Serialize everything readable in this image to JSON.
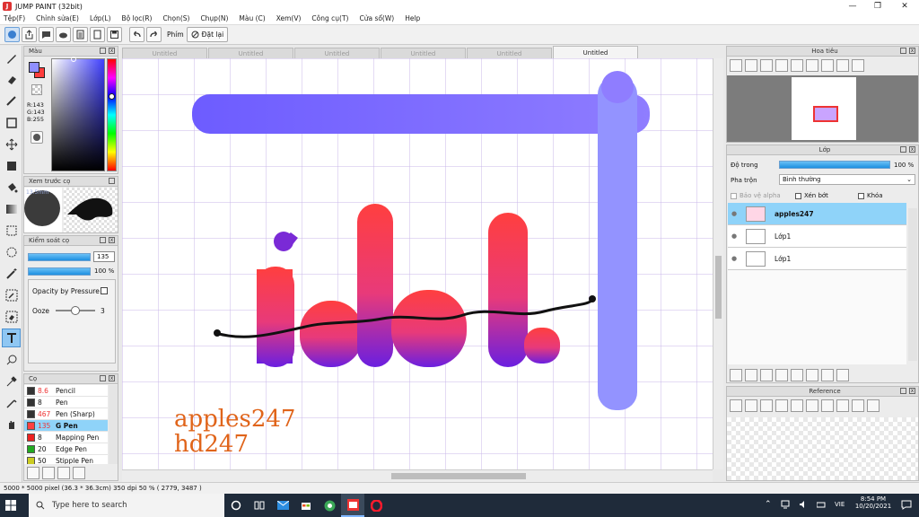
{
  "window": {
    "title": "JUMP PAINT (32bit)",
    "app_letter": "J"
  },
  "menu": [
    "Tệp(F)",
    "Chỉnh sửa(E)",
    "Lớp(L)",
    "Bộ lọc(R)",
    "Chọn(S)",
    "Chụp(N)",
    "Màu (C)",
    "Xem(V)",
    "Công cụ(T)",
    "Cửa sổ(W)",
    "Help"
  ],
  "toolbar": {
    "phim_label": "Phím",
    "reset_label": "Đặt lại"
  },
  "tabs": [
    "Untitled",
    "Untitled",
    "Untitled",
    "Untitled",
    "Untitled",
    "Untitled"
  ],
  "color_panel": {
    "title": "Màu",
    "r": "R:143",
    "g": "G:143",
    "b": "B:255",
    "fg_color": "#8f8fff",
    "bg_color": "#ff3c3c"
  },
  "preview_panel": {
    "title": "Xem trước cọ",
    "size_text": "13.5mm"
  },
  "brush_control": {
    "title": "Kiểm soát cọ",
    "size_value": "135",
    "opacity_value": "100 %",
    "opacity_pressure_label": "Opacity by Pressure",
    "ooze_label": "Ooze",
    "ooze_value": "3",
    "ooze_level": 0.5
  },
  "brush_list": {
    "title": "Cọ",
    "items": [
      {
        "num": "8.6",
        "name": "Pencil",
        "color": "#333333",
        "red": true
      },
      {
        "num": "8",
        "name": "Pen",
        "color": "#333333"
      },
      {
        "num": "467",
        "name": "Pen (Sharp)",
        "color": "#333333",
        "red": true
      },
      {
        "num": "135",
        "name": "G Pen",
        "color": "#ff4040",
        "selected": true
      },
      {
        "num": "8",
        "name": "Mapping Pen",
        "color": "#ee2222"
      },
      {
        "num": "20",
        "name": "Edge Pen",
        "color": "#22aa22"
      },
      {
        "num": "50",
        "name": "Stipple Pen",
        "color": "#cccc22"
      }
    ]
  },
  "navigator": {
    "title": "Hoa tiêu"
  },
  "layer_panel": {
    "title": "Lớp",
    "opacity_label": "Độ trong",
    "opacity_value": "100 %",
    "blend_label": "Pha trộn",
    "blend_value": "Bình thường",
    "protect_alpha": "Bảo vệ alpha",
    "clip_label": "Xén bớt",
    "lock_label": "Khóa",
    "layers": [
      {
        "name": "apples247",
        "selected": true
      },
      {
        "name": "Lớp1"
      },
      {
        "name": "Lớp1"
      }
    ]
  },
  "reference_panel": {
    "title": "Reference"
  },
  "canvas": {
    "line1": "apples247",
    "line2": "hd247",
    "word": "idol"
  },
  "status": {
    "text": "5000 * 5000 pixel   (36.3 * 36.3cm)   350 dpi   50 %   ( 2779, 3487 )"
  },
  "taskbar": {
    "search_placeholder": "Type here to search",
    "lang": "VIE",
    "time": "8:54 PM",
    "date": "10/20/2021"
  }
}
